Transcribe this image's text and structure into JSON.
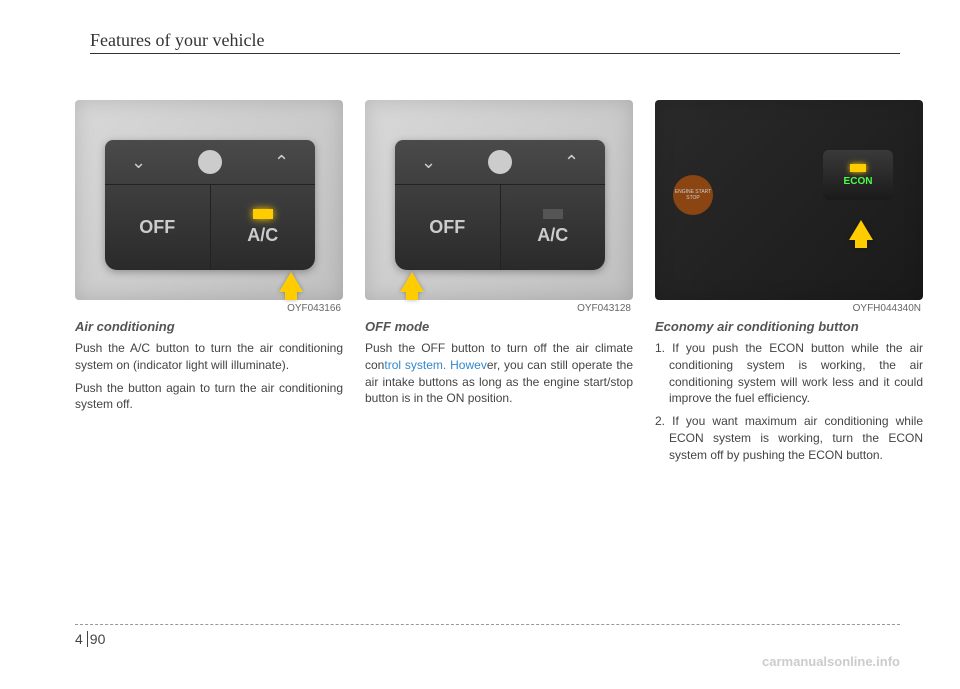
{
  "header": {
    "title": "Features of your vehicle"
  },
  "columns": {
    "col1": {
      "image_code": "OYF043166",
      "panel_off_label": "OFF",
      "panel_ac_label": "A/C",
      "title": "Air conditioning",
      "p1": "Push the A/C button to turn the air conditioning system on (indicator light will illuminate).",
      "p2": "Push the button again to turn the air conditioning system off."
    },
    "col2": {
      "image_code": "OYF043128",
      "panel_off_label": "OFF",
      "panel_ac_label": "A/C",
      "title": "OFF mode",
      "p1_pre": "Push the OFF button to turn off the air climate con",
      "watermark": "trol system. Howev",
      "p1_post": "er, you can still operate the air intake buttons as long as the engine start/stop button is in the ON position."
    },
    "col3": {
      "image_code": "OYFH044340N",
      "econ_label": "ECON",
      "engine_label": "ENGINE START STOP",
      "title": "Economy air conditioning button",
      "item1": "1. If you push the ECON button while the air conditioning system is working, the air conditioning system will work less and it could improve the fuel efficiency.",
      "item2": "2. If you want maximum air conditioning while ECON system is working, turn the ECON system off by pushing the ECON button."
    }
  },
  "footer": {
    "section": "4",
    "page": "90",
    "brand": "carmanualsonline.info"
  }
}
